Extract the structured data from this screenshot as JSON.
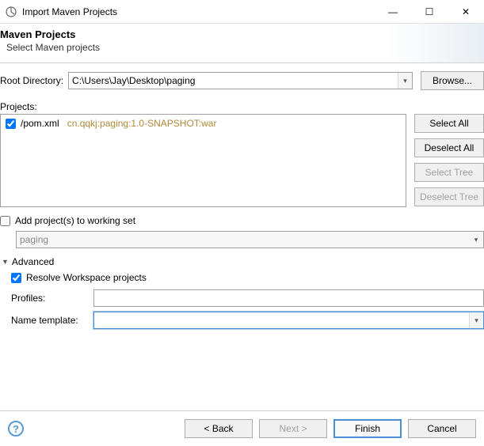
{
  "window": {
    "title": "Import Maven Projects",
    "controls": {
      "min": "—",
      "max": "☐",
      "close": "✕"
    }
  },
  "header": {
    "title": "Maven Projects",
    "subtitle": "Select Maven projects"
  },
  "root": {
    "label": "Root Directory:",
    "value": "C:\\Users\\Jay\\Desktop\\paging",
    "browse": "Browse..."
  },
  "projects": {
    "label": "Projects:",
    "items": [
      {
        "checked": true,
        "pom": "/pom.xml",
        "gav": "cn.qqkj:paging:1.0-SNAPSHOT:war"
      }
    ],
    "buttons": {
      "select_all": "Select All",
      "deselect_all": "Deselect All",
      "select_tree": "Select Tree",
      "deselect_tree": "Deselect Tree"
    }
  },
  "working_set": {
    "checkbox_label": "Add project(s) to working set",
    "checked": false,
    "value": "paging"
  },
  "advanced": {
    "label": "Advanced",
    "expanded": true,
    "resolve": {
      "label": "Resolve Workspace projects",
      "checked": true
    },
    "profiles": {
      "label": "Profiles:",
      "value": ""
    },
    "name_template": {
      "label": "Name template:",
      "value": ""
    }
  },
  "footer": {
    "back": "< Back",
    "next": "Next >",
    "finish": "Finish",
    "cancel": "Cancel"
  }
}
